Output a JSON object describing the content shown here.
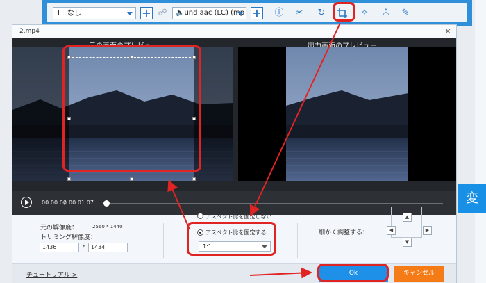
{
  "background_app": {
    "subtitle_select": "なし",
    "subtitle_icon": "text-icon",
    "audio_select": "und aac (LC) (mp",
    "audio_icon": "speaker-icon",
    "tool_icons": [
      "info-icon",
      "scissors-icon",
      "rotate-icon",
      "crop-icon",
      "magic-wand-icon",
      "watermark-icon",
      "edit-icon"
    ],
    "convert_label": "変"
  },
  "dialog": {
    "title": "2.mp4",
    "close_label": "✕"
  },
  "preview": {
    "original_label": "元の画面のプレビュー",
    "output_label": "出力画面のプレビュー"
  },
  "playback": {
    "current_time": "00:00:00",
    "separator": "/",
    "total_time": "00:01:07",
    "progress": 0.0
  },
  "settings": {
    "original_resolution_label": "元の解像度：",
    "original_resolution_value": "2560 * 1440",
    "trim_resolution_label": "トリミング解像度：",
    "width_value": "1436",
    "multiply_sign": "*",
    "height_value": "1434",
    "radio_unfixed_label": "アスペクト比を固定しない",
    "radio_fixed_label": "アスペクト比を固定する",
    "ratio_value": "1:1",
    "fine_adjust_label": "細かく調整する：",
    "arrow_up": "▲",
    "arrow_down": "▼",
    "arrow_left": "◀",
    "arrow_right": "▶"
  },
  "footer": {
    "tutorial_link": "チュートリアル >",
    "ok_label": "Ok",
    "cancel_label": "キャンセル"
  },
  "colors": {
    "toolbar_blue": "#2f8fd8",
    "ok_blue": "#1e90e8",
    "cancel_orange": "#f57b16",
    "annotation_red": "#e02424"
  }
}
